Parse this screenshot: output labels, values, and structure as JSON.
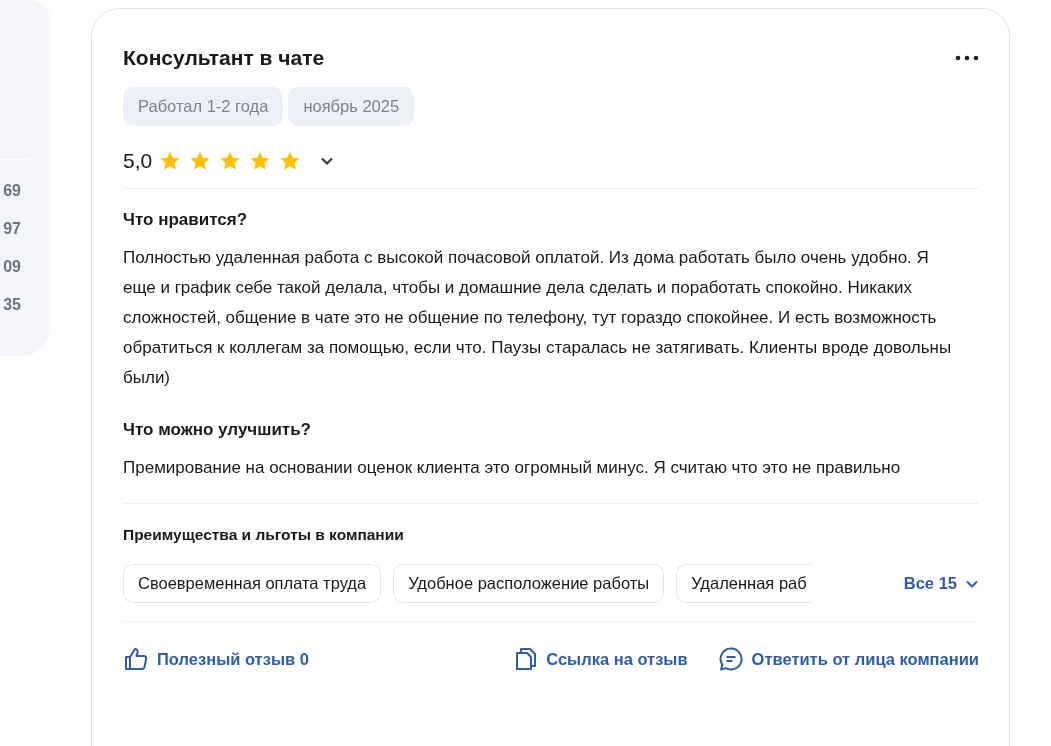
{
  "side_panel": {
    "values": [
      "69",
      "97",
      "09",
      "35"
    ]
  },
  "review": {
    "title": "Консультант в чате",
    "tags": [
      "Работал 1-2 года",
      "ноябрь 2025"
    ],
    "rating": {
      "value": "5,0",
      "stars": 5
    },
    "sections": [
      {
        "heading": "Что нравится?",
        "text": "Полностью удаленная работа с высокой почасовой оплатой. Из дома работать было очень удобно. Я еще и график себе такой делала, чтобы и домашние дела сделать и поработать спокойно. Никаких сложностей, общение в чате это не общение по телефону, тут гораздо спокойнее. И есть возможность обратиться к коллегам за помощью, если что. Паузы старалась не затягивать. Клиенты вроде довольны были)"
      },
      {
        "heading": "Что можно улучшить?",
        "text": "Премирование на основании оценок клиента это огромный минус. Я считаю что это не правильно"
      }
    ],
    "benefits": {
      "heading": "Преимущества и льготы в компании",
      "items": [
        "Своевременная оплата труда",
        "Удобное расположение работы",
        "Удаленная раб"
      ],
      "more": "Все 15"
    },
    "actions": [
      {
        "kind": "like",
        "label": "Полезный отзыв 0"
      },
      {
        "kind": "link",
        "label": "Ссылка на отзыв"
      },
      {
        "kind": "reply",
        "label": "Ответить от лица компании"
      }
    ]
  }
}
